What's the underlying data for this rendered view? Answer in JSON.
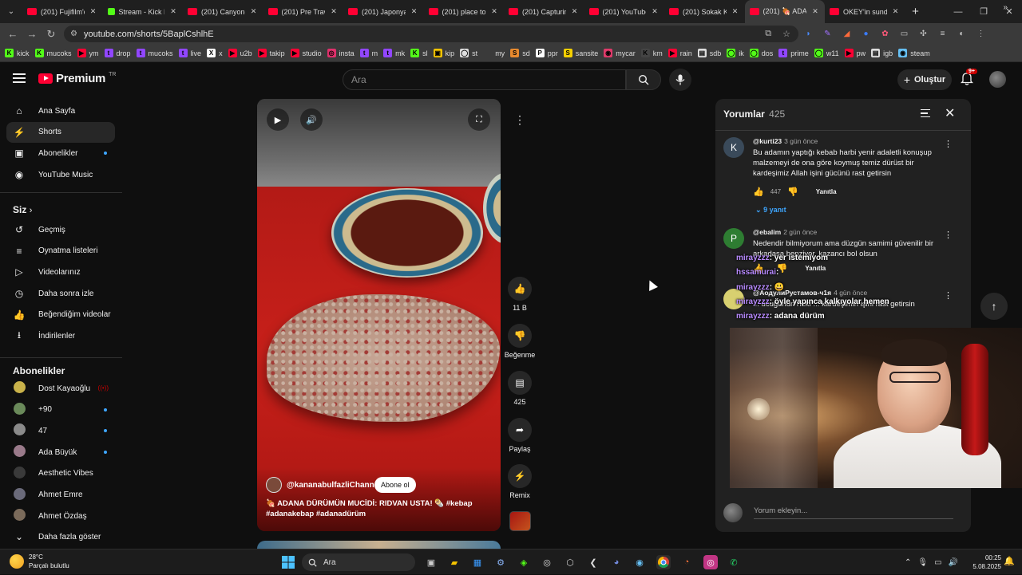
{
  "browser": {
    "tabs": [
      {
        "title": "(201) Fujifilm'da",
        "type": "yt"
      },
      {
        "title": "Stream - Kick D",
        "type": "kick"
      },
      {
        "title": "(201) Canyone",
        "type": "yt"
      },
      {
        "title": "(201) Pre Trave",
        "type": "yt"
      },
      {
        "title": "(201) Japonya'",
        "type": "yt"
      },
      {
        "title": "(201) place to",
        "type": "yt"
      },
      {
        "title": "(201) Capturing",
        "type": "yt"
      },
      {
        "title": "(201) YouTube",
        "type": "yt"
      },
      {
        "title": "(201) Sokak Ko",
        "type": "yt"
      },
      {
        "title": "(201) 🍖 ADAN",
        "type": "yt",
        "active": true
      },
      {
        "title": "OKEY'in sundu",
        "type": "okey"
      }
    ],
    "url": "youtube.com/shorts/5BaplCshlhE"
  },
  "bookmarks": [
    {
      "label": "kick",
      "color": "#53fc18",
      "glyph": "K"
    },
    {
      "label": "mucoks",
      "color": "#53fc18",
      "glyph": "K"
    },
    {
      "label": "ym",
      "color": "#ff0033",
      "glyph": "▶"
    },
    {
      "label": "drop",
      "color": "#9146ff",
      "glyph": "t"
    },
    {
      "label": "mucoks",
      "color": "#9146ff",
      "glyph": "t"
    },
    {
      "label": "live",
      "color": "#9146ff",
      "glyph": "t"
    },
    {
      "label": "x",
      "color": "#ffffff",
      "glyph": "X"
    },
    {
      "label": "u2b",
      "color": "#ff0033",
      "glyph": "▶"
    },
    {
      "label": "takip",
      "color": "#ff0033",
      "glyph": "▶"
    },
    {
      "label": "studio",
      "color": "#ff0033",
      "glyph": "▶"
    },
    {
      "label": "insta",
      "color": "#e1306c",
      "glyph": "◎"
    },
    {
      "label": "m",
      "color": "#9146ff",
      "glyph": "t"
    },
    {
      "label": "mk",
      "color": "#9146ff",
      "glyph": "t"
    },
    {
      "label": "sl",
      "color": "#53fc18",
      "glyph": "K"
    },
    {
      "label": "kip",
      "color": "#f5c400",
      "glyph": "▣"
    },
    {
      "label": "st",
      "color": "#dddddd",
      "glyph": "◯"
    },
    {
      "label": "my",
      "color": "#3a3a3a",
      "glyph": ""
    },
    {
      "label": "sd",
      "color": "#e88a2e",
      "glyph": "S"
    },
    {
      "label": "ppr",
      "color": "#ffffff",
      "glyph": "P"
    },
    {
      "label": "sansite",
      "color": "#f5d000",
      "glyph": "S"
    },
    {
      "label": "mycar",
      "color": "#e03a6a",
      "glyph": "◉"
    },
    {
      "label": "km",
      "color": "#444444",
      "glyph": "K"
    },
    {
      "label": "rain",
      "color": "#ff0033",
      "glyph": "▶"
    },
    {
      "label": "sdb",
      "color": "#dddddd",
      "glyph": "▤"
    },
    {
      "label": "ik",
      "color": "#53fc18",
      "glyph": "◯"
    },
    {
      "label": "dos",
      "color": "#53fc18",
      "glyph": "◯"
    },
    {
      "label": "prime",
      "color": "#9146ff",
      "glyph": "t"
    },
    {
      "label": "w11",
      "color": "#53fc18",
      "glyph": "◯"
    },
    {
      "label": "pw",
      "color": "#ff0033",
      "glyph": "▶"
    },
    {
      "label": "igb",
      "color": "#dddddd",
      "glyph": "▤"
    },
    {
      "label": "steam",
      "color": "#66c0f4",
      "glyph": "◉"
    }
  ],
  "header": {
    "logo_text": "Premium",
    "logo_region": "TR",
    "search_placeholder": "Ara",
    "create_label": "Oluştur",
    "notifications_badge": "9+"
  },
  "sidebar": {
    "main": [
      {
        "label": "Ana Sayfa",
        "icon": "home-icon",
        "glyph": "⌂"
      },
      {
        "label": "Shorts",
        "icon": "shorts-icon",
        "glyph": "⚡",
        "active": true
      },
      {
        "label": "Abonelikler",
        "icon": "subscriptions-icon",
        "glyph": "▣",
        "dot": true
      },
      {
        "label": "YouTube Music",
        "icon": "music-icon",
        "glyph": "◉"
      }
    ],
    "you_title": "Siz",
    "you": [
      {
        "label": "Geçmiş",
        "icon": "history-icon",
        "glyph": "↺"
      },
      {
        "label": "Oynatma listeleri",
        "icon": "playlists-icon",
        "glyph": "≡"
      },
      {
        "label": "Videolarınız",
        "icon": "your-videos-icon",
        "glyph": "▷"
      },
      {
        "label": "Daha sonra izle",
        "icon": "watch-later-icon",
        "glyph": "◷"
      },
      {
        "label": "Beğendiğim videolar",
        "icon": "liked-videos-icon",
        "glyph": "👍"
      },
      {
        "label": "İndirilenler",
        "icon": "downloads-icon",
        "glyph": "⭳"
      }
    ],
    "subs_title": "Abonelikler",
    "subs": [
      {
        "label": "Dost Kayaoğlu",
        "color": "#c9b24a",
        "live": true
      },
      {
        "label": "+90",
        "color": "#6a8a5a",
        "dot": true
      },
      {
        "label": "47",
        "color": "#8a8a8a",
        "dot": true
      },
      {
        "label": "Ada Büyük",
        "color": "#9a7a8a",
        "dot": true
      },
      {
        "label": "Aesthetic Vibes",
        "color": "#3a3a3a"
      },
      {
        "label": "Ahmet Emre",
        "color": "#6a6a7a"
      },
      {
        "label": "Ahmet Özdaş",
        "color": "#7a6a5a"
      }
    ],
    "show_more": "Daha fazla göster"
  },
  "short": {
    "channel": "@kananabulfazliChannel",
    "subscribe": "Abone ol",
    "title": "🍖 ADANA DÜRÜMÜN MUCİDİ: RIDVAN USTA! 🌯 #kebap #adanakebap #adanadürüm",
    "likes": "11 B",
    "dislike_label": "Beğenme",
    "comments_count": "425",
    "share_label": "Paylaş",
    "remix_label": "Remix"
  },
  "comments_panel": {
    "title": "Yorumlar",
    "count": "425",
    "reply_label": "Yanıtla",
    "add_placeholder": "Yorum ekleyin...",
    "items": [
      {
        "author": "@kurti23",
        "time": "3 gün önce",
        "initial": "K",
        "color": "#3a4a5a",
        "text": "Bu adamın yaptığı kebab harbi yenir adaletli konuşup malzemeyi de ona göre koymuş  temiz dürüst bir kardeşimiz Allah işini gücünü rast getirsin",
        "likes": "447",
        "replies": "9 yanıt"
      },
      {
        "author": "@ebalim",
        "time": "2 gün önce",
        "initial": "P",
        "color": "#2e7d32",
        "text": "Nedendir bilmiyorum ama düzgün samimi güvenilir bir arkadaşa benziyor. kazancı bol olsun",
        "likes": ""
      },
      {
        "author": "@АодулиРустамов-ч1я",
        "time": "4 gün önce",
        "initial": "",
        "color": "#d8d070",
        "text": "... ucuğunun rızkı ... kardeşimin işini rast getirsin",
        "likes": ""
      }
    ]
  },
  "stream_chat": [
    {
      "user": "mirayzzz",
      "text": "yer istemiyom"
    },
    {
      "user": "hssamurai",
      "text": ""
    },
    {
      "user": "mirayzzz",
      "text": "😃"
    },
    {
      "user": "mirayzzz",
      "text": "öyle yapınca kalkıyolar hemen"
    },
    {
      "user": "mirayzzz",
      "text": "adana dürüm"
    }
  ],
  "taskbar": {
    "temperature": "28°C",
    "weather": "Parçalı bulutlu",
    "search": "Ara",
    "time": "00:25",
    "date": "5.08.2025"
  }
}
